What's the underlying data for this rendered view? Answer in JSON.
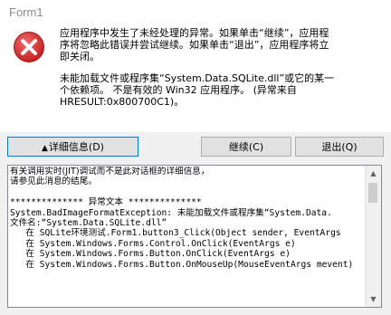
{
  "window": {
    "title": "Form1"
  },
  "message": {
    "line1": "应用程序中发生了未经处理的异常。如果单击“继续”，应用程",
    "line2": "序将忽略此错误并尝试继续。如果单击“退出”，应用程序将立",
    "line3": "即关闭。",
    "line4": "未能加载文件或程序集“System.Data.SQLite.dll”或它的某一",
    "line5": "个依赖项。 不是有效的 Win32 应用程序。 (异常来自",
    "line6": "HRESULT:0x800700C1)。"
  },
  "buttons": {
    "details": "详细信息(D)",
    "continue": "继续(C)",
    "quit": "退出(Q)"
  },
  "details": {
    "intro1": "有关调用实时(JIT)调试而不是此对话框的详细信息，",
    "intro2": "请参见此消息的结尾。",
    "section": "************** 异常文本 **************",
    "exception": "System.BadImageFormatException: 未能加载文件或程序集“System.Data.",
    "filename": "文件名:“System.Data.SQLite.dll”",
    "stack1": "   在 SQLite环境测试.Form1.button3_Click(Object sender, EventArgs",
    "stack2": "   在 System.Windows.Forms.Control.OnClick(EventArgs e)",
    "stack3": "   在 System.Windows.Forms.Button.OnClick(EventArgs e)",
    "stack4": "   在 System.Windows.Forms.Button.OnMouseUp(MouseEventArgs mevent)"
  },
  "icons": {
    "error": "error-icon",
    "details_arrow": "up-triangle-icon"
  },
  "colors": {
    "error_red": "#d92b2b",
    "focus_border": "#0078d7",
    "button_face": "#e1e1e1",
    "dialog_bg": "#f0f0f0"
  }
}
